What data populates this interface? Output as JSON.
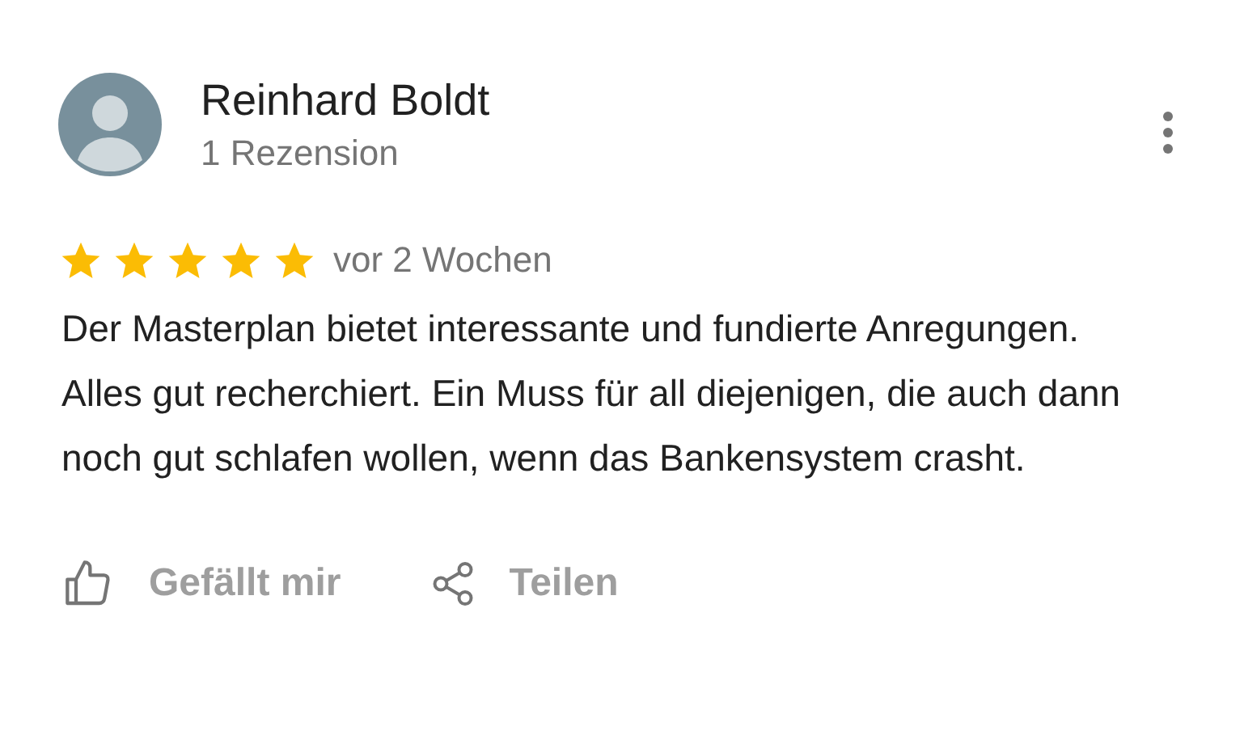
{
  "review": {
    "author": "Reinhard Boldt",
    "author_meta": "1 Rezension",
    "stars": 5,
    "date": "vor 2 Wochen",
    "text": "Der Masterplan bietet interessante und fundierte Anregungen. Alles gut recherchiert. Ein Muss für all diejenigen, die auch dann noch gut schlafen wollen, wenn das Bankensystem crasht.",
    "actions": [
      {
        "kind": "like",
        "label": "Gefällt mir"
      },
      {
        "kind": "share",
        "label": "Teilen"
      }
    ]
  }
}
